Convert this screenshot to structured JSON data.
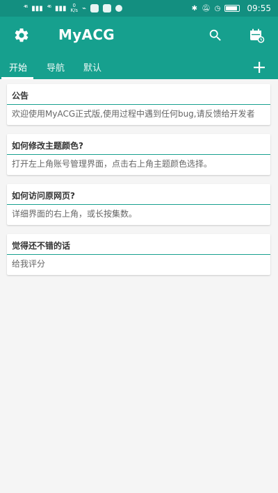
{
  "status_bar": {
    "signal_1": "⁴⁶",
    "signal_2": "⁴⁶",
    "speed_value": "0",
    "speed_unit": "K/s",
    "time": "09:55"
  },
  "app_bar": {
    "title": "MyACG",
    "accent_color": "#16a08e",
    "status_color": "#138f80"
  },
  "tabs": [
    {
      "label": "开始"
    },
    {
      "label": "导航"
    },
    {
      "label": "默认"
    }
  ],
  "cards": [
    {
      "title": "公告",
      "body": "欢迎使用MyACG正式版,使用过程中遇到任何bug,请反馈给开发者"
    },
    {
      "title": "如何修改主题颜色?",
      "body": "打开左上角账号管理界面，点击右上角主题颜色选择。"
    },
    {
      "title": "如何访问原网页?",
      "body": "详细界面的右上角，或长按集数。"
    },
    {
      "title": "觉得还不错的话",
      "body": "给我评分"
    }
  ]
}
